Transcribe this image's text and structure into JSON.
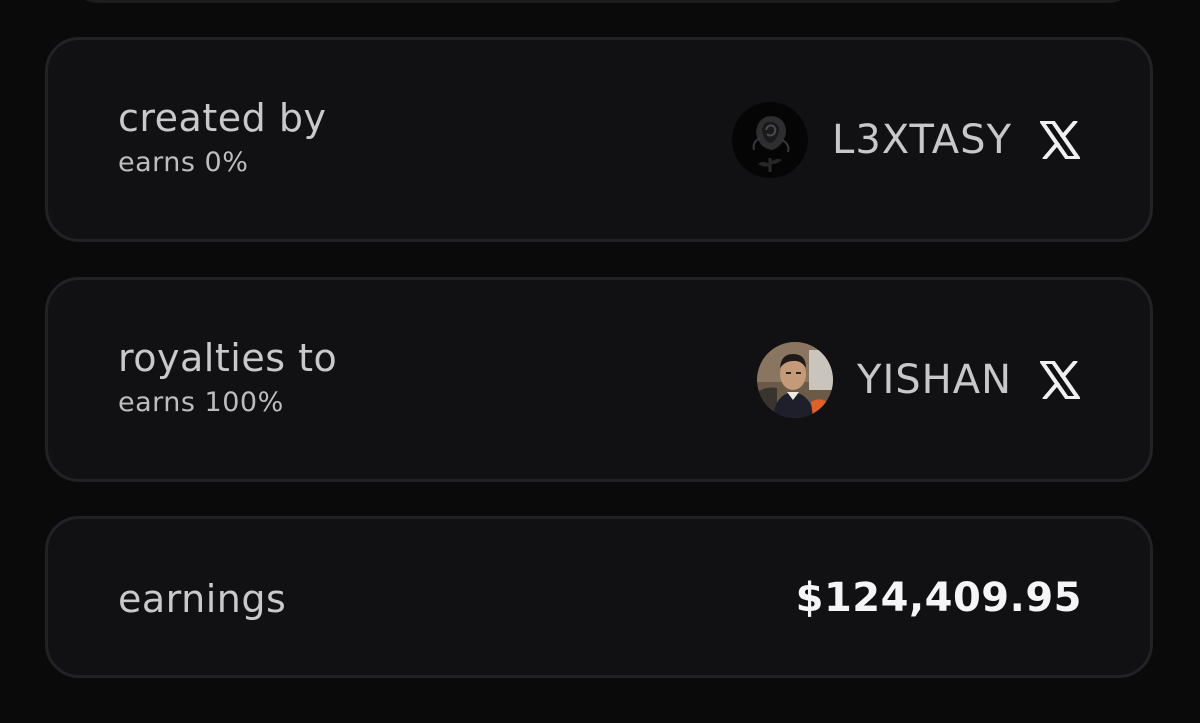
{
  "created_by": {
    "label": "created by",
    "earns": "earns 0%",
    "name": "L3XTASY",
    "avatar_icon": "black-rose-avatar",
    "social_icon": "x-logo-icon"
  },
  "royalties_to": {
    "label": "royalties to",
    "earns": "earns 100%",
    "name": "YISHAN",
    "avatar_icon": "person-photo-avatar",
    "social_icon": "x-logo-icon"
  },
  "earnings": {
    "label": "earnings",
    "value": "$124,409.95"
  },
  "colors": {
    "background": "#0a0a0b",
    "card": "#111113",
    "card_border": "#222226",
    "text": "#c9c9cc",
    "value": "#f5f5f7"
  }
}
